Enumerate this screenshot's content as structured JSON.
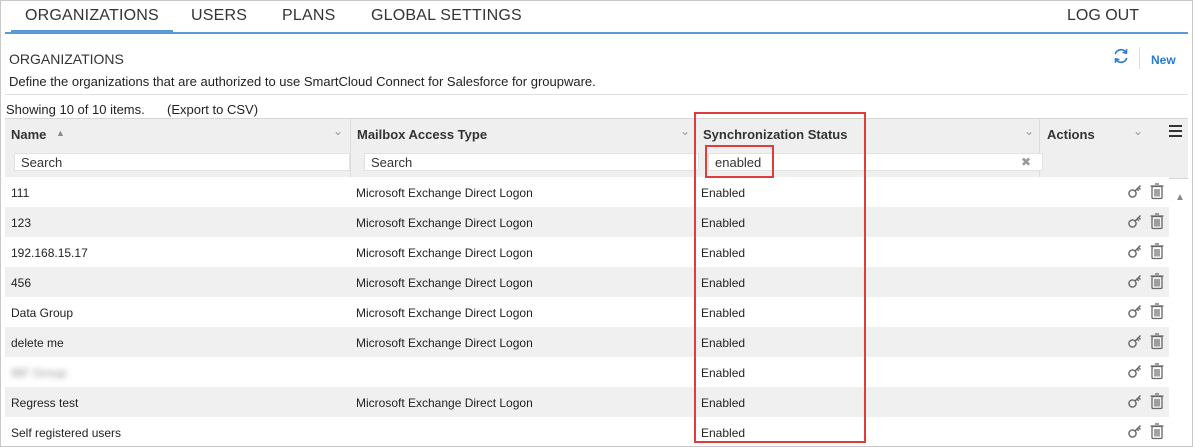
{
  "nav": {
    "tabs": [
      "ORGANIZATIONS",
      "USERS",
      "PLANS",
      "GLOBAL SETTINGS"
    ],
    "logout": "LOG OUT"
  },
  "page": {
    "title": "ORGANIZATIONS",
    "description": "Define the organizations that are authorized to use SmartCloud Connect for Salesforce for groupware.",
    "new_label": "New"
  },
  "grid": {
    "showing": "Showing 10 of 10 items.",
    "export": "(Export to CSV)",
    "columns": {
      "name": "Name",
      "mailbox": "Mailbox Access Type",
      "sync": "Synchronization Status",
      "actions": "Actions"
    },
    "filters": {
      "name_placeholder": "Search",
      "mailbox_placeholder": "Search",
      "sync_value": "enabled"
    },
    "rows": [
      {
        "name": "111",
        "mailbox": "Microsoft Exchange Direct Logon",
        "status": "Enabled"
      },
      {
        "name": "123",
        "mailbox": "Microsoft Exchange Direct Logon",
        "status": "Enabled"
      },
      {
        "name": "192.168.15.17",
        "mailbox": "Microsoft Exchange Direct Logon",
        "status": "Enabled"
      },
      {
        "name": "456",
        "mailbox": "Microsoft Exchange Direct Logon",
        "status": "Enabled"
      },
      {
        "name": "Data Group",
        "mailbox": "Microsoft Exchange Direct Logon",
        "status": "Enabled"
      },
      {
        "name": "delete me",
        "mailbox": "Microsoft Exchange Direct Logon",
        "status": "Enabled"
      },
      {
        "name": "IBF Group",
        "mailbox": "",
        "status": "Enabled",
        "blurred": true
      },
      {
        "name": "Regress test",
        "mailbox": "Microsoft Exchange Direct Logon",
        "status": "Enabled"
      },
      {
        "name": "Self registered users",
        "mailbox": "",
        "status": "Enabled"
      }
    ]
  },
  "colors": {
    "accent": "#5b9bd5",
    "link": "#2a7bd1",
    "highlight": "#e03c3c"
  },
  "icons": [
    "refresh-icon",
    "key-icon",
    "trash-icon",
    "menu-icon",
    "sort-ascending-icon",
    "chevron-down-icon",
    "clear-icon"
  ]
}
